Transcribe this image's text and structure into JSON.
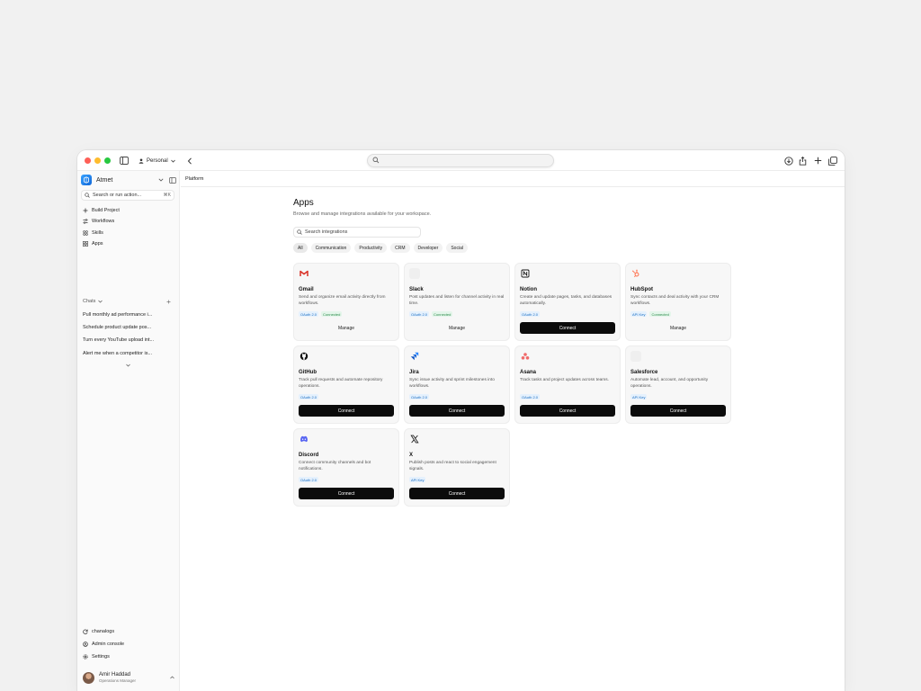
{
  "browser": {
    "profile_label": "Personal",
    "url": ""
  },
  "sidebar": {
    "workspace_name": "Atmet",
    "search_placeholder": "Search or run action...",
    "search_shortcut": "⌘K",
    "nav": [
      {
        "label": "Build Project",
        "icon": "plus-icon"
      },
      {
        "label": "Workflows",
        "icon": "workflow-icon"
      },
      {
        "label": "Skills",
        "icon": "skills-icon"
      },
      {
        "label": "Apps",
        "icon": "apps-grid-icon"
      }
    ],
    "chats_label": "Chats",
    "chats": [
      {
        "title": "Pull monthly ad performance i..."
      },
      {
        "title": "Schedule product update pos..."
      },
      {
        "title": "Turn every YouTube upload int..."
      },
      {
        "title": "Alert me when a competitor is..."
      }
    ],
    "bottom": [
      {
        "label": "chanalogs",
        "icon": "refresh-icon"
      },
      {
        "label": "Admin console",
        "icon": "admin-icon"
      },
      {
        "label": "Settings",
        "icon": "gear-icon"
      }
    ],
    "user": {
      "name": "Amir Haddad",
      "role": "Operations Manager"
    }
  },
  "breadcrumb": "Platform",
  "page": {
    "title": "Apps",
    "subtitle": "Browse and manage integrations available for your workspace.",
    "search_placeholder": "Search integrations"
  },
  "filters": [
    {
      "label": "All",
      "active": true
    },
    {
      "label": "Communication",
      "active": false
    },
    {
      "label": "Productivity",
      "active": false
    },
    {
      "label": "CRM",
      "active": false
    },
    {
      "label": "Developer",
      "active": false
    },
    {
      "label": "Social",
      "active": false
    }
  ],
  "apps": [
    {
      "name": "Gmail",
      "icon": "gmail-icon",
      "description": "Send and organize email activity directly from workflows.",
      "auth": "OAuth 2.0",
      "status": "Connected",
      "action": "Manage"
    },
    {
      "name": "Slack",
      "icon": "slack-icon",
      "description": "Post updates and listen for channel activity in real time.",
      "auth": "OAuth 2.0",
      "status": "Connected",
      "action": "Manage"
    },
    {
      "name": "Notion",
      "icon": "notion-icon",
      "description": "Create and update pages, tasks, and databases automatically.",
      "auth": "OAuth 2.0",
      "status": "",
      "action": "Connect"
    },
    {
      "name": "HubSpot",
      "icon": "hubspot-icon",
      "description": "Sync contacts and deal activity with your CRM workflows.",
      "auth": "API Key",
      "status": "Connected",
      "action": "Manage"
    },
    {
      "name": "GitHub",
      "icon": "github-icon",
      "description": "Track pull requests and automate repository operations.",
      "auth": "OAuth 2.0",
      "status": "",
      "action": "Connect"
    },
    {
      "name": "Jira",
      "icon": "jira-icon",
      "description": "Sync issue activity and sprint milestones into workflows.",
      "auth": "OAuth 2.0",
      "status": "",
      "action": "Connect"
    },
    {
      "name": "Asana",
      "icon": "asana-icon",
      "description": "Track tasks and project updates across teams.",
      "auth": "OAuth 2.0",
      "status": "",
      "action": "Connect"
    },
    {
      "name": "Salesforce",
      "icon": "salesforce-icon",
      "description": "Automate lead, account, and opportunity operations.",
      "auth": "API Key",
      "status": "",
      "action": "Connect"
    },
    {
      "name": "Discord",
      "icon": "discord-icon",
      "description": "Connect community channels and bot notifications.",
      "auth": "OAuth 2.0",
      "status": "",
      "action": "Connect"
    },
    {
      "name": "X",
      "icon": "x-icon",
      "description": "Publish posts and react to social engagement signals.",
      "auth": "API Key",
      "status": "",
      "action": "Connect"
    }
  ]
}
